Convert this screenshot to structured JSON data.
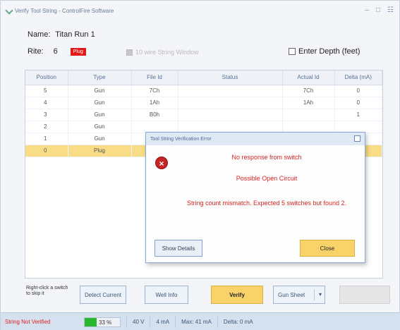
{
  "window": {
    "title": "Verify Tool String - ControlFire Software"
  },
  "header": {
    "name_label": "Name:",
    "name_value": "Titan Run 1",
    "rite_label": "Rite:",
    "rite_value": "6",
    "badge": "Plug",
    "ten_wire_label": "10 wire String Window",
    "enter_depth_label": "Enter Depth (feet)"
  },
  "table": {
    "columns": [
      "Position",
      "Type",
      "File Id",
      "Status",
      "Actual Id",
      "Delta (mA)"
    ],
    "rows": [
      {
        "position": "5",
        "type": "Gun",
        "file_id": "7Ch",
        "status": "",
        "actual_id": "7Ch",
        "delta": "0"
      },
      {
        "position": "4",
        "type": "Gun",
        "file_id": "1Ah",
        "status": "",
        "actual_id": "1Ah",
        "delta": "0"
      },
      {
        "position": "3",
        "type": "Gun",
        "file_id": "B0h",
        "status": "",
        "actual_id": "",
        "delta": "1"
      },
      {
        "position": "2",
        "type": "Gun",
        "file_id": "",
        "status": "",
        "actual_id": "",
        "delta": ""
      },
      {
        "position": "1",
        "type": "Gun",
        "file_id": "",
        "status": "",
        "actual_id": "",
        "delta": ""
      },
      {
        "position": "0",
        "type": "Plug",
        "file_id": "",
        "status": "",
        "actual_id": "",
        "delta": ""
      }
    ]
  },
  "dialog": {
    "title": "Tool String Verification Error",
    "msg1": "No response from switch",
    "msg2": "Possible Open Circuit",
    "msg3": "String count mismatch. Expected 5 switches but found 2.",
    "details_button": "Show Details",
    "close_button": "Close"
  },
  "bottom": {
    "hint": "Right-click a switch to skip it",
    "detect_button": "Detect Current",
    "well_button": "Well Info",
    "verify_button": "Verify",
    "gunsheet_button": "Gun Sheet"
  },
  "status": {
    "error": "String Not Verified",
    "progress_text": "33 %",
    "progress": 0.33,
    "voltage": "40 V",
    "current": "4 mA",
    "max": "Max: 41 mA",
    "delta": "Delta: 0 mA"
  },
  "colors": {
    "error_red": "#e01919",
    "accent_yellow": "#f9d36a",
    "progress_green": "#27b72e"
  }
}
